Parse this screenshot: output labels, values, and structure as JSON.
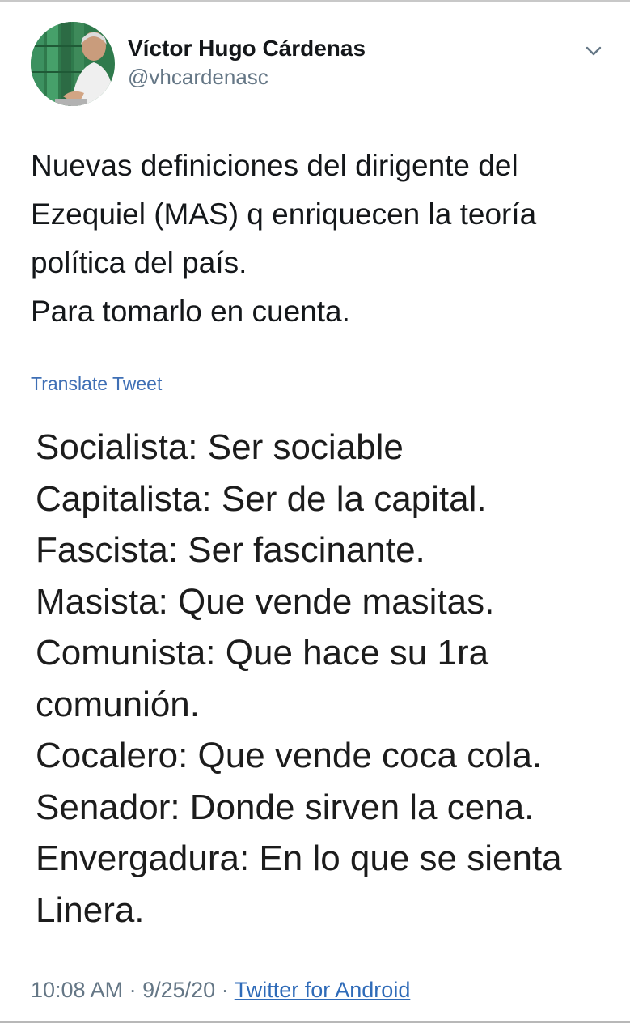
{
  "author": {
    "display_name": "Víctor Hugo Cárdenas",
    "handle": "@vhcardenasc",
    "avatar_icon": "profile-photo"
  },
  "menu_icon": "chevron-down-icon",
  "tweet": {
    "text_lines": [
      "Nuevas definiciones del dirigente del",
      "Ezequiel (MAS) q enriquecen la teoría",
      "política del país.",
      "Para tomarlo en cuenta."
    ],
    "translate_label": "Translate Tweet"
  },
  "attached_image": {
    "lines": [
      "Socialista: Ser sociable",
      "Capitalista: Ser de la capital.",
      "Fascista: Ser fascinante.",
      "Masista: Que vende masitas.",
      "Comunista: Que hace su 1ra",
      "comunión.",
      "Cocalero: Que vende coca cola.",
      "Senador: Donde sirven la cena.",
      "Envergadura: En lo que se sienta",
      "Linera."
    ]
  },
  "meta": {
    "time": "10:08 AM",
    "date": "9/25/20",
    "separator": "·",
    "source": "Twitter for Android"
  },
  "colors": {
    "link": "#3f6fb5",
    "secondary_text": "#657786",
    "primary_text": "#14171a"
  }
}
